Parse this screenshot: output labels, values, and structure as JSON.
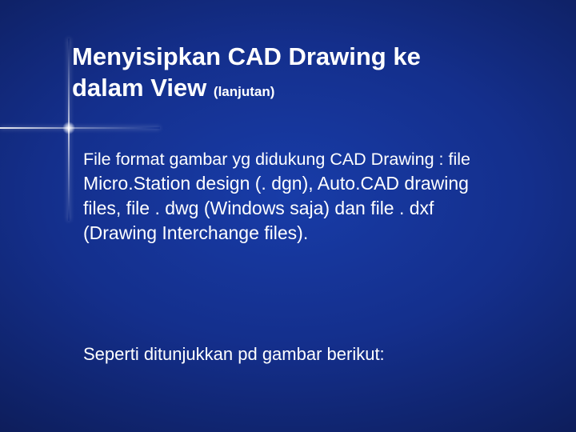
{
  "title": {
    "line1": "Menyisipkan CAD Drawing ke",
    "line2_main": "dalam View ",
    "line2_sub": "(lanjutan)"
  },
  "body": {
    "lead_in": " File format gambar yg didukung CAD Drawing : file ",
    "main": "Micro.Station design (. dgn), Auto.CAD drawing files, file . dwg (Windows saja) dan file . dxf (Drawing Interchange files)."
  },
  "footer": "Seperti ditunjukkan pd gambar berikut:"
}
